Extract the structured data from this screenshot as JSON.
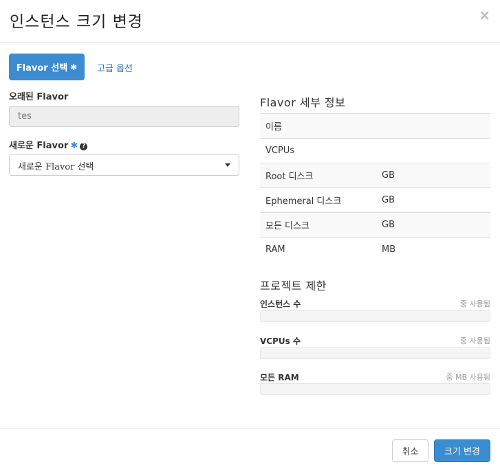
{
  "modal": {
    "title": "인스턴스 크기 변경",
    "close": "×"
  },
  "tabs": [
    {
      "label": "Flavor 선택",
      "required": "✱",
      "active": true
    },
    {
      "label": "고급 옵션",
      "active": false
    }
  ],
  "form": {
    "old_flavor_label": "오래된 Flavor",
    "old_flavor_value": "tes",
    "new_flavor_label": "새로운 Flavor",
    "new_flavor_required": "✱",
    "new_flavor_help": "?",
    "new_flavor_selected": "새로운 Flavor 선택"
  },
  "flavor_details": {
    "title": "Flavor 세부 정보",
    "rows": [
      {
        "name": "이름",
        "unit": ""
      },
      {
        "name": "VCPUs",
        "unit": ""
      },
      {
        "name": "Root 디스크",
        "unit": "GB"
      },
      {
        "name": "Ephemeral 디스크",
        "unit": "GB"
      },
      {
        "name": "모든 디스크",
        "unit": "GB"
      },
      {
        "name": "RAM",
        "unit": "MB"
      }
    ]
  },
  "project_limits": {
    "title": "프로젝트 제한",
    "quotas": [
      {
        "label": "인스턴스 수",
        "used_text": "중 사용됨",
        "fill": 0
      },
      {
        "label": "VCPUs 수",
        "used_text": "중 사용됨",
        "fill": 0
      },
      {
        "label": "모든 RAM",
        "used_text": "중 MB 사용됨",
        "fill": 0
      }
    ]
  },
  "footer": {
    "cancel_label": "취소",
    "submit_label": "크기 변경"
  },
  "colors": {
    "primary": "#3b8cd0",
    "link": "#2a6fb0"
  }
}
